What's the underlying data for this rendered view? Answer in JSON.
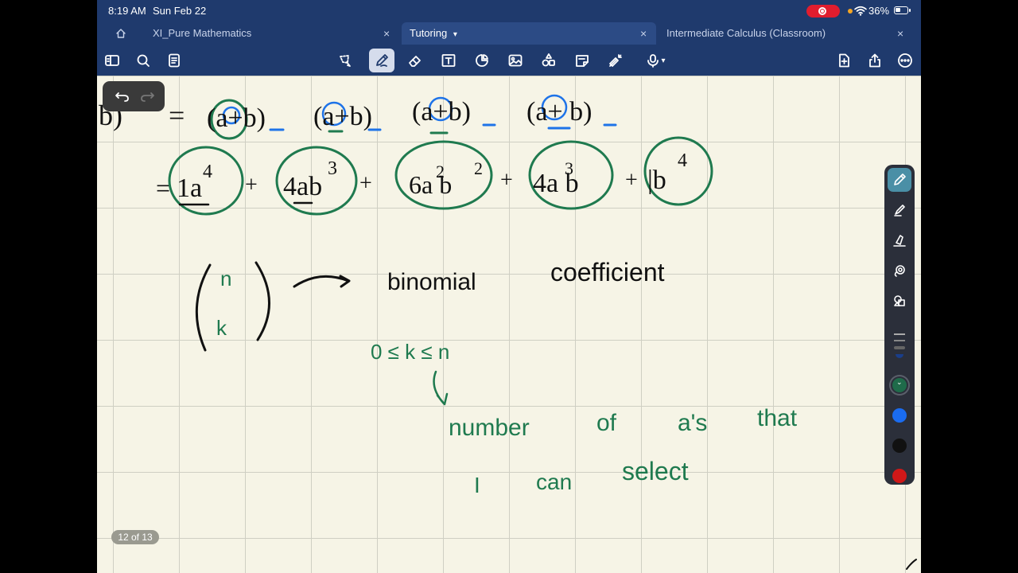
{
  "status_bar": {
    "time": "8:19 AM",
    "date": "Sun Feb 22",
    "battery": "36%",
    "recording_color": "#e11d2e"
  },
  "tabs": [
    {
      "label": "XI_Pure Mathematics",
      "active": false
    },
    {
      "label": "Tutoring",
      "active": true
    },
    {
      "label": "Intermediate Calculus (Classroom)",
      "active": false
    }
  ],
  "toolbar": {
    "left_icons": [
      "sidebar-icon",
      "search-icon",
      "document-icon"
    ],
    "center_icons": [
      "lasso-icon",
      "pen-icon",
      "eraser-icon",
      "textbox-icon",
      "shapes-icon",
      "image-icon",
      "sticker-icon",
      "note-icon",
      "laser-icon",
      "mic-icon"
    ],
    "right_icons": [
      "add-page-icon",
      "share-icon",
      "more-icon"
    ]
  },
  "page": {
    "counter": "12 of 13"
  },
  "handwriting": {
    "line1": "b) = (a+b)(a+b)(a+b)(a+b)",
    "line2": "= 1a^4 + 4ab^3 + 6a^2b^2 + 4a^3b + 1b^4",
    "binomial_top": "n",
    "binomial_bottom": "k",
    "binomial_label": "binomial",
    "coefficient_label": "coefficient",
    "inequality": "0 ≤ k ≤ n",
    "note_line1_a": "number",
    "note_line1_b": "of",
    "note_line1_c": "a's",
    "note_line1_d": "that",
    "note_line2_a": "I",
    "note_line2_b": "can",
    "note_line2_c": "select"
  },
  "tool_palette": {
    "tools": [
      "pen-tool-icon",
      "highlighter-icon",
      "marker-icon",
      "lasso-select-icon",
      "shapes-tool-icon"
    ],
    "swatches": [
      "#1f6b4a",
      "#1a6cf0",
      "#111111",
      "#d01818"
    ],
    "selected_swatch": "#1f6b4a"
  },
  "colors": {
    "ink_black": "#111111",
    "ink_green": "#1f7a4f",
    "ink_blue": "#1e73e8",
    "topbar": "#1f3a6d",
    "paper": "#f6f4e6"
  }
}
